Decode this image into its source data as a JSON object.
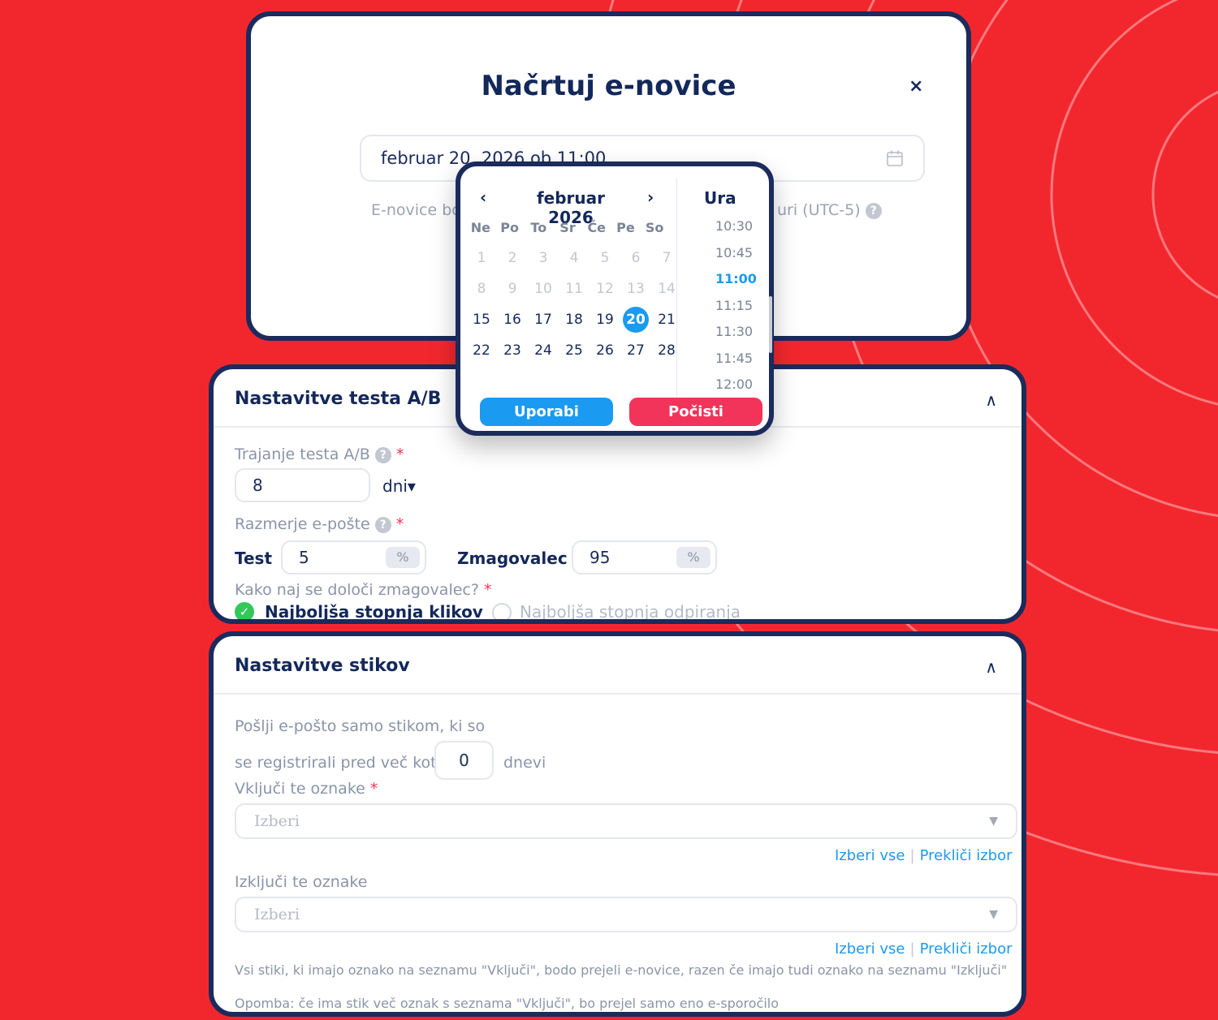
{
  "modal": {
    "title": "Načrtuj e-novice",
    "close": "×",
    "date_value": "februar 20, 2026 ob 11:00",
    "note_left": "E-novice bo",
    "note_right": "uri (UTC-5)",
    "help": "?"
  },
  "picker": {
    "prev": "‹",
    "next": "›",
    "month": "februar 2026",
    "weekdays": [
      "Ne",
      "Po",
      "To",
      "Sr",
      "Če",
      "Pe",
      "So"
    ],
    "weeks": [
      [
        "1",
        "2",
        "3",
        "4",
        "5",
        "6",
        "7"
      ],
      [
        "8",
        "9",
        "10",
        "11",
        "12",
        "13",
        "14"
      ],
      [
        "15",
        "16",
        "17",
        "18",
        "19",
        "20",
        "21"
      ],
      [
        "22",
        "23",
        "24",
        "25",
        "26",
        "27",
        "28"
      ]
    ],
    "disabled_weeks": 2,
    "selected_day": "20",
    "hour_title": "Ura",
    "times": [
      "10:30",
      "10:45",
      "11:00",
      "11:15",
      "11:30",
      "11:45",
      "12:00"
    ],
    "selected_time": "11:00",
    "apply": "Uporabi",
    "clear": "Počisti",
    "apply_color": "#1a9af0",
    "clear_color": "#f2335a"
  },
  "ab": {
    "title": "Nastavitve testa A/B",
    "chevron": "∧",
    "duration_label": "Trajanje testa A/B",
    "duration_value": "8",
    "duration_unit": "dni▾",
    "ratio_label": "Razmerje e-pošte",
    "test_label": "Test",
    "test_value": "5",
    "winner_label": "Zmagovalec",
    "winner_value": "95",
    "percent": "%",
    "winner_question": "Kako naj se določi zmagovalec?",
    "option_clicks": "Najboljša stopnja klikov",
    "option_opens": "Najboljša stopnja odpiranja",
    "required": "*"
  },
  "contacts": {
    "title": "Nastavitve stikov",
    "chevron": "∧",
    "send_only_1": "Pošlji e-pošto samo stikom, ki so",
    "send_only_2": "se registrirali pred več kot",
    "days_value": "0",
    "days_unit": "dnevi",
    "include_label": "Vključi te oznake",
    "include_placeholder": "Izberi",
    "exclude_label": "Izključi te oznake",
    "exclude_placeholder": "Izberi",
    "select_all": "Izberi vse",
    "deselect": "Prekliči izbor",
    "separator": "|",
    "info": "Vsi stiki, ki imajo oznako na seznamu \"Vključi\", bodo prejeli e-novice, razen če imajo tudi oznako na seznamu \"Izključi\"",
    "note": "Opomba: če ima stik več oznak s seznama \"Vključi\", bo prejel samo eno e-sporočilo",
    "required": "*"
  },
  "colors": {
    "background": "#f2272e",
    "navy": "#1a2b5c",
    "accent": "#1a9af0",
    "success": "#34c759"
  },
  "icons": {
    "calendar": "calendar-icon",
    "help": "help-icon",
    "check": "check-icon"
  }
}
